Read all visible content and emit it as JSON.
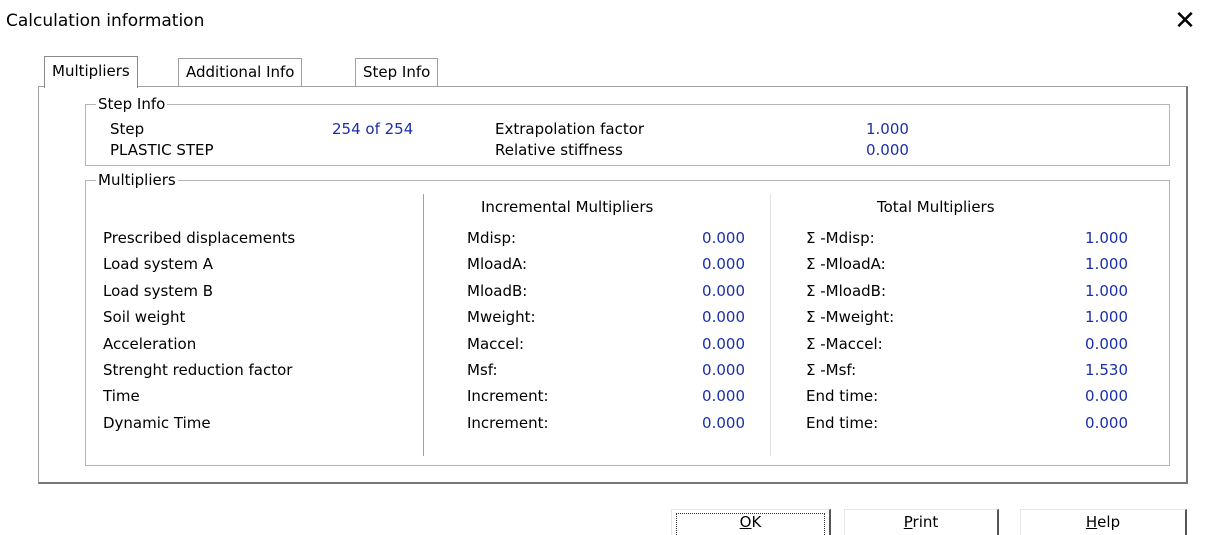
{
  "window": {
    "title": "Calculation information"
  },
  "tabs": [
    {
      "label": "Multipliers",
      "active": true
    },
    {
      "label": "Additional Info",
      "active": false
    },
    {
      "label": "Step Info",
      "active": false
    }
  ],
  "step_info": {
    "legend": "Step Info",
    "step_label": "Step",
    "step_value": "254 of 254",
    "plastic_label": "PLASTIC STEP",
    "extrapolation_label": "Extrapolation factor",
    "extrapolation_value": "1.000",
    "stiffness_label": "Relative stiffness",
    "stiffness_value": "0.000"
  },
  "multipliers": {
    "legend": "Multipliers",
    "incremental_header": "Incremental Multipliers",
    "total_header": "Total Multipliers",
    "rows": [
      {
        "label": "Prescribed displacements",
        "inc_name": "Mdisp:",
        "inc_value": "0.000",
        "tot_name": "Σ -Mdisp:",
        "tot_value": "1.000"
      },
      {
        "label": "Load system A",
        "inc_name": "MloadA:",
        "inc_value": "0.000",
        "tot_name": "Σ -MloadA:",
        "tot_value": "1.000"
      },
      {
        "label": "Load system B",
        "inc_name": "MloadB:",
        "inc_value": "0.000",
        "tot_name": "Σ -MloadB:",
        "tot_value": "1.000"
      },
      {
        "label": "Soil weight",
        "inc_name": "Mweight:",
        "inc_value": "0.000",
        "tot_name": "Σ -Mweight:",
        "tot_value": "1.000"
      },
      {
        "label": "Acceleration",
        "inc_name": "Maccel:",
        "inc_value": "0.000",
        "tot_name": "Σ -Maccel:",
        "tot_value": "0.000"
      },
      {
        "label": "Strenght reduction factor",
        "inc_name": "Msf:",
        "inc_value": "0.000",
        "tot_name": "Σ -Msf:",
        "tot_value": "1.530"
      },
      {
        "label": "Time",
        "inc_name": "Increment:",
        "inc_value": "0.000",
        "tot_name": "End time:",
        "tot_value": "0.000"
      },
      {
        "label": "Dynamic Time",
        "inc_name": "Increment:",
        "inc_value": "0.000",
        "tot_name": "End time:",
        "tot_value": "0.000"
      }
    ]
  },
  "buttons": {
    "ok": {
      "mnemonic": "O",
      "rest": "K"
    },
    "print": {
      "mnemonic": "P",
      "rest": "rint"
    },
    "help": {
      "mnemonic": "H",
      "rest": "elp"
    }
  },
  "icons": {
    "close": "close-icon"
  }
}
